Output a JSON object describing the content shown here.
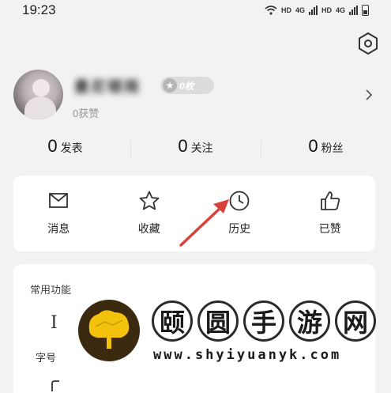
{
  "status_bar": {
    "time": "19:23",
    "network_labels": [
      "HD",
      "4G",
      "HD",
      "4G"
    ]
  },
  "profile": {
    "nickname": "曼尼顿雨",
    "badge": "0枚",
    "likes": "0获赞"
  },
  "stats": [
    {
      "num": "0",
      "label": "发表"
    },
    {
      "num": "0",
      "label": "关注"
    },
    {
      "num": "0",
      "label": "粉丝"
    }
  ],
  "actions": [
    {
      "label": "消息",
      "icon": "message-icon"
    },
    {
      "label": "收藏",
      "icon": "star-icon"
    },
    {
      "label": "历史",
      "icon": "clock-icon"
    },
    {
      "label": "已赞",
      "icon": "thumbs-up-icon"
    }
  ],
  "tools": {
    "title": "常用功能",
    "font_size_label": "字号"
  },
  "watermark": {
    "chars": [
      "颐",
      "圆",
      "手",
      "游",
      "网"
    ],
    "url": "www.shyiyuanyk.com"
  },
  "colors": {
    "background": "#f2f2f2",
    "card": "#ffffff",
    "annotation_arrow": "#d9423a"
  }
}
